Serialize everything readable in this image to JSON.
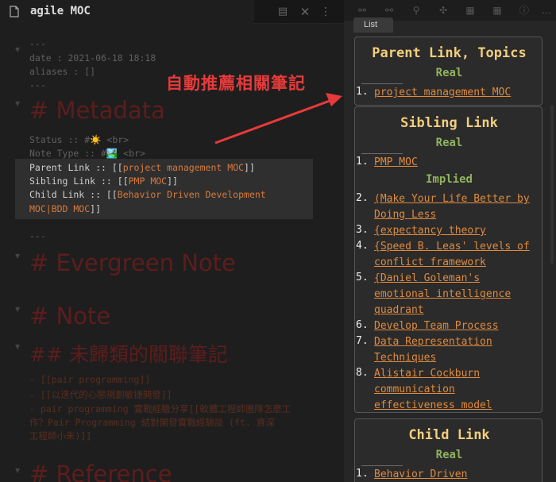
{
  "editor": {
    "tab_title": "agile MOC",
    "frontmatter": {
      "open": "---",
      "date": "date : 2021-06-18 18:18",
      "aliases": "aliases : []",
      "close": "---"
    },
    "h_metadata": "# Metadata",
    "status_line": "Status :: #☀️  <br>",
    "notetype_line": "Note Type :: #🏞️  <br>",
    "parent_label": "Parent Link :: [[",
    "parent_link": "project management MOC",
    "parent_close": "]]",
    "sibling_label": "Sibling Link :: [[",
    "sibling_link": "PMP MOC",
    "sibling_close": "]]",
    "child_label": "Child  Link  ::  [[",
    "child_link_a": "Behavior  Driven  Development",
    "child_link_b": "MOC|BDD MOC",
    "child_close": "]]",
    "separator": "---",
    "h_evergreen": "# Evergreen Note",
    "h_note": "# Note",
    "h_unclassified": "## 未歸類的關聯筆記",
    "list_1": "- [[pair programming]]",
    "list_2": "- [[以迭代的心態規劃敏捷開發]]",
    "list_3a": "- pair programming 實戰經驗分享[[軟體工程師團隊怎麼工",
    "list_3b": "  作？Pair Programming 結對開發實戰經驗談 (ft. 資深",
    "list_3c": "  工程師小朱)]]",
    "h_reference": "# Reference"
  },
  "annotation": "自動推薦相關筆記",
  "sidebar": {
    "list_tab": "List",
    "parent_card": {
      "title": "Parent Link, Topics",
      "real_label": "Real",
      "items": [
        {
          "num": "1.",
          "text": "project management MOC"
        }
      ]
    },
    "sibling_card": {
      "title": "Sibling Link",
      "real_label": "Real",
      "implied_label": "Implied",
      "items": [
        {
          "num": "1.",
          "text": "PMP MOC"
        },
        {
          "num": "2.",
          "text": "(Make Your Life Better by Doing Less"
        },
        {
          "num": "3.",
          "text": "{expectancy theory"
        },
        {
          "num": "4.",
          "text": "{Speed B. Leas' levels of conflict framework"
        },
        {
          "num": "5.",
          "text": "{Daniel Goleman's emotional intelligence quadrant"
        },
        {
          "num": "6.",
          "text": "Develop Team Process"
        },
        {
          "num": "7.",
          "text": "Data Representation Techniques"
        },
        {
          "num": "8.",
          "text": "Alistair Cockburn communication effectiveness model"
        }
      ]
    },
    "child_card": {
      "title": "Child Link",
      "real_label": "Real",
      "items": [
        {
          "num": "1.",
          "text": "Behavior Driven"
        }
      ]
    }
  },
  "colors": {
    "heading_dim": "#5d1d1d",
    "link": "#e08a3c",
    "card_title": "#f2ce7d",
    "sub_label": "#8fb35d",
    "annotation": "#e83a3a"
  }
}
